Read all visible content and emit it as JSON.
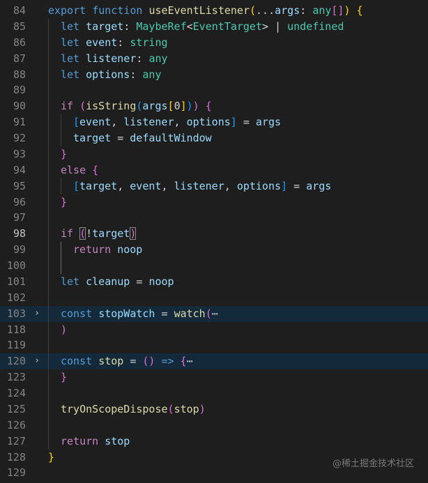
{
  "editor": {
    "colors": {
      "background": "#1e1e1e",
      "line_number": "#858585",
      "folded_line_bg": "#14293a",
      "keyword": "#569cd6",
      "control": "#c586c0",
      "function": "#dcdcaa",
      "variable": "#9cdcfe",
      "type": "#4ec9b0"
    },
    "lines": [
      {
        "n": "84",
        "indent": 0,
        "tokens": [
          [
            "kw",
            "export"
          ],
          [
            "plain",
            " "
          ],
          [
            "kw",
            "function"
          ],
          [
            "plain",
            " "
          ],
          [
            "fn",
            "useEventListener"
          ],
          [
            "p1",
            "("
          ],
          [
            "plain",
            "..."
          ],
          [
            "var",
            "args"
          ],
          [
            "plain",
            ": "
          ],
          [
            "type",
            "any"
          ],
          [
            "p2",
            "[]"
          ],
          [
            "p1",
            ")"
          ],
          [
            "plain",
            " "
          ],
          [
            "p1",
            "{"
          ]
        ]
      },
      {
        "n": "85",
        "indent": 1,
        "tokens": [
          [
            "kw",
            "let"
          ],
          [
            "plain",
            " "
          ],
          [
            "var",
            "target"
          ],
          [
            "plain",
            ": "
          ],
          [
            "type",
            "MaybeRef"
          ],
          [
            "plain",
            "<"
          ],
          [
            "type",
            "EventTarget"
          ],
          [
            "plain",
            "> | "
          ],
          [
            "type",
            "undefined"
          ]
        ]
      },
      {
        "n": "86",
        "indent": 1,
        "tokens": [
          [
            "kw",
            "let"
          ],
          [
            "plain",
            " "
          ],
          [
            "var",
            "event"
          ],
          [
            "plain",
            ": "
          ],
          [
            "type",
            "string"
          ]
        ]
      },
      {
        "n": "87",
        "indent": 1,
        "tokens": [
          [
            "kw",
            "let"
          ],
          [
            "plain",
            " "
          ],
          [
            "var",
            "listener"
          ],
          [
            "plain",
            ": "
          ],
          [
            "type",
            "any"
          ]
        ]
      },
      {
        "n": "88",
        "indent": 1,
        "tokens": [
          [
            "kw",
            "let"
          ],
          [
            "plain",
            " "
          ],
          [
            "var",
            "options"
          ],
          [
            "plain",
            ": "
          ],
          [
            "type",
            "any"
          ]
        ]
      },
      {
        "n": "89",
        "indent": 1,
        "tokens": []
      },
      {
        "n": "90",
        "indent": 1,
        "tokens": [
          [
            "ctl",
            "if"
          ],
          [
            "plain",
            " "
          ],
          [
            "p2",
            "("
          ],
          [
            "fn",
            "isString"
          ],
          [
            "p3",
            "("
          ],
          [
            "var",
            "args"
          ],
          [
            "p1",
            "["
          ],
          [
            "plain",
            "0"
          ],
          [
            "p1",
            "]"
          ],
          [
            "p3",
            ")"
          ],
          [
            "p2",
            ")"
          ],
          [
            "plain",
            " "
          ],
          [
            "p2",
            "{"
          ]
        ]
      },
      {
        "n": "91",
        "indent": 2,
        "tokens": [
          [
            "p3",
            "["
          ],
          [
            "var",
            "event"
          ],
          [
            "plain",
            ", "
          ],
          [
            "var",
            "listener"
          ],
          [
            "plain",
            ", "
          ],
          [
            "var",
            "options"
          ],
          [
            "p3",
            "]"
          ],
          [
            "plain",
            " = "
          ],
          [
            "var",
            "args"
          ]
        ]
      },
      {
        "n": "92",
        "indent": 2,
        "tokens": [
          [
            "var",
            "target"
          ],
          [
            "plain",
            " = "
          ],
          [
            "var",
            "defaultWindow"
          ]
        ]
      },
      {
        "n": "93",
        "indent": 1,
        "tokens": [
          [
            "p2",
            "}"
          ]
        ]
      },
      {
        "n": "94",
        "indent": 1,
        "tokens": [
          [
            "ctl",
            "else"
          ],
          [
            "plain",
            " "
          ],
          [
            "p2",
            "{"
          ]
        ]
      },
      {
        "n": "95",
        "indent": 2,
        "tokens": [
          [
            "p3",
            "["
          ],
          [
            "var",
            "target"
          ],
          [
            "plain",
            ", "
          ],
          [
            "var",
            "event"
          ],
          [
            "plain",
            ", "
          ],
          [
            "var",
            "listener"
          ],
          [
            "plain",
            ", "
          ],
          [
            "var",
            "options"
          ],
          [
            "p3",
            "]"
          ],
          [
            "plain",
            " = "
          ],
          [
            "var",
            "args"
          ]
        ]
      },
      {
        "n": "96",
        "indent": 1,
        "tokens": [
          [
            "p2",
            "}"
          ]
        ]
      },
      {
        "n": "97",
        "indent": 1,
        "tokens": []
      },
      {
        "n": "98",
        "indent": 1,
        "active": true,
        "tokens": [
          [
            "ctl",
            "if"
          ],
          [
            "plain",
            " "
          ],
          [
            "p2m",
            "("
          ],
          [
            "plain",
            "!"
          ],
          [
            "var",
            "target"
          ],
          [
            "p2m",
            ")"
          ]
        ]
      },
      {
        "n": "99",
        "indent": 2,
        "tokens": [
          [
            "ctl",
            "return"
          ],
          [
            "plain",
            " "
          ],
          [
            "var",
            "noop"
          ]
        ]
      },
      {
        "n": "100",
        "indent": 2,
        "tokens": []
      },
      {
        "n": "101",
        "indent": 1,
        "tokens": [
          [
            "kw",
            "let"
          ],
          [
            "plain",
            " "
          ],
          [
            "var",
            "cleanup"
          ],
          [
            "plain",
            " = "
          ],
          [
            "var",
            "noop"
          ]
        ]
      },
      {
        "n": "102",
        "indent": 1,
        "tokens": []
      },
      {
        "n": "103",
        "indent": 1,
        "fold": "›",
        "folded": true,
        "tokens": [
          [
            "kw",
            "const"
          ],
          [
            "plain",
            " "
          ],
          [
            "var",
            "stopWatch"
          ],
          [
            "plain",
            " = "
          ],
          [
            "fn",
            "watch"
          ],
          [
            "p2",
            "("
          ],
          [
            "ell",
            "⋯"
          ]
        ]
      },
      {
        "n": "118",
        "indent": 1,
        "tokens": [
          [
            "p2",
            ")"
          ]
        ]
      },
      {
        "n": "119",
        "indent": 1,
        "tokens": []
      },
      {
        "n": "120",
        "indent": 1,
        "fold": "›",
        "folded": true,
        "tokens": [
          [
            "kw",
            "const"
          ],
          [
            "plain",
            " "
          ],
          [
            "fn",
            "stop"
          ],
          [
            "plain",
            " = "
          ],
          [
            "p2",
            "()"
          ],
          [
            "plain",
            " "
          ],
          [
            "kw",
            "=>"
          ],
          [
            "plain",
            " "
          ],
          [
            "p2",
            "{"
          ],
          [
            "ell",
            "⋯"
          ]
        ]
      },
      {
        "n": "123",
        "indent": 1,
        "tokens": [
          [
            "p2",
            "}"
          ]
        ]
      },
      {
        "n": "124",
        "indent": 1,
        "tokens": []
      },
      {
        "n": "125",
        "indent": 1,
        "tokens": [
          [
            "fn",
            "tryOnScopeDispose"
          ],
          [
            "p2",
            "("
          ],
          [
            "fn",
            "stop"
          ],
          [
            "p2",
            ")"
          ]
        ]
      },
      {
        "n": "126",
        "indent": 1,
        "tokens": []
      },
      {
        "n": "127",
        "indent": 1,
        "tokens": [
          [
            "ctl",
            "return"
          ],
          [
            "plain",
            " "
          ],
          [
            "var",
            "stop"
          ]
        ]
      },
      {
        "n": "128",
        "indent": 0,
        "tokens": [
          [
            "p1",
            "}"
          ]
        ]
      },
      {
        "n": "129",
        "indent": 0,
        "tokens": []
      }
    ]
  },
  "watermark": "@稀土掘金技术社区"
}
